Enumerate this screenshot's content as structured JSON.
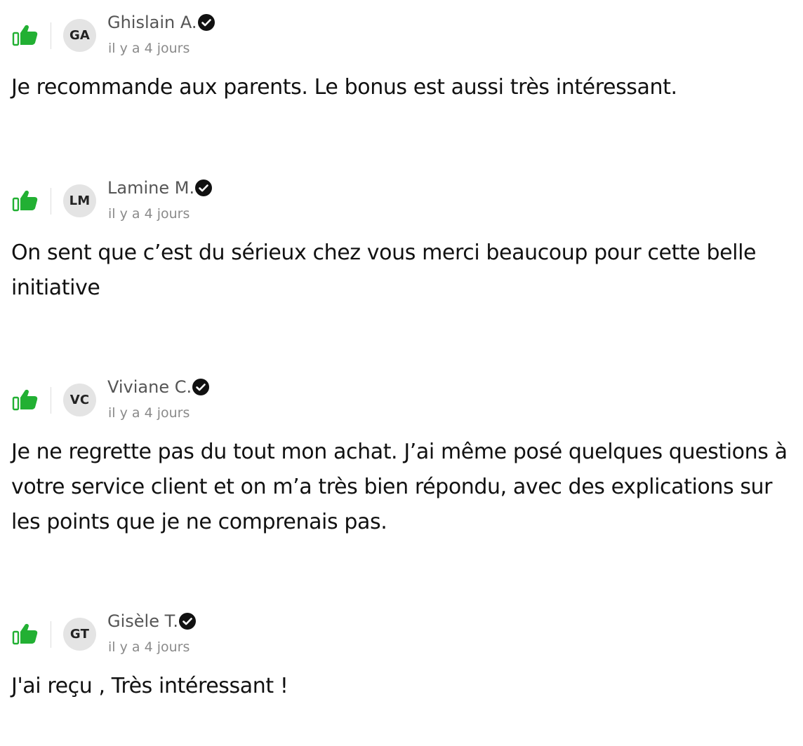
{
  "colors": {
    "thumb": "#22b033",
    "verified_badge": "#111111",
    "avatar_bg": "#e4e4e4"
  },
  "reviews": [
    {
      "avatar_initials": "GA",
      "author": "Ghislain A.",
      "time": "il y a 4 jours",
      "text": "Je recommande aux parents. Le bonus est aussi très intéressant."
    },
    {
      "avatar_initials": "LM",
      "author": "Lamine M.",
      "time": "il y a 4 jours",
      "text": "On sent que c’est du sérieux chez vous merci beaucoup pour cette belle initiative"
    },
    {
      "avatar_initials": "VC",
      "author": "Viviane C.",
      "time": "il y a 4 jours",
      "text": "Je ne regrette pas du tout mon achat. J’ai même posé quelques questions à votre service client et on m’a très bien répondu, avec des explications sur les points que je ne comprenais pas."
    },
    {
      "avatar_initials": "GT",
      "author": "Gisèle T.",
      "time": "il y a 4 jours",
      "text": "J'ai reçu , Très intéressant !"
    }
  ]
}
